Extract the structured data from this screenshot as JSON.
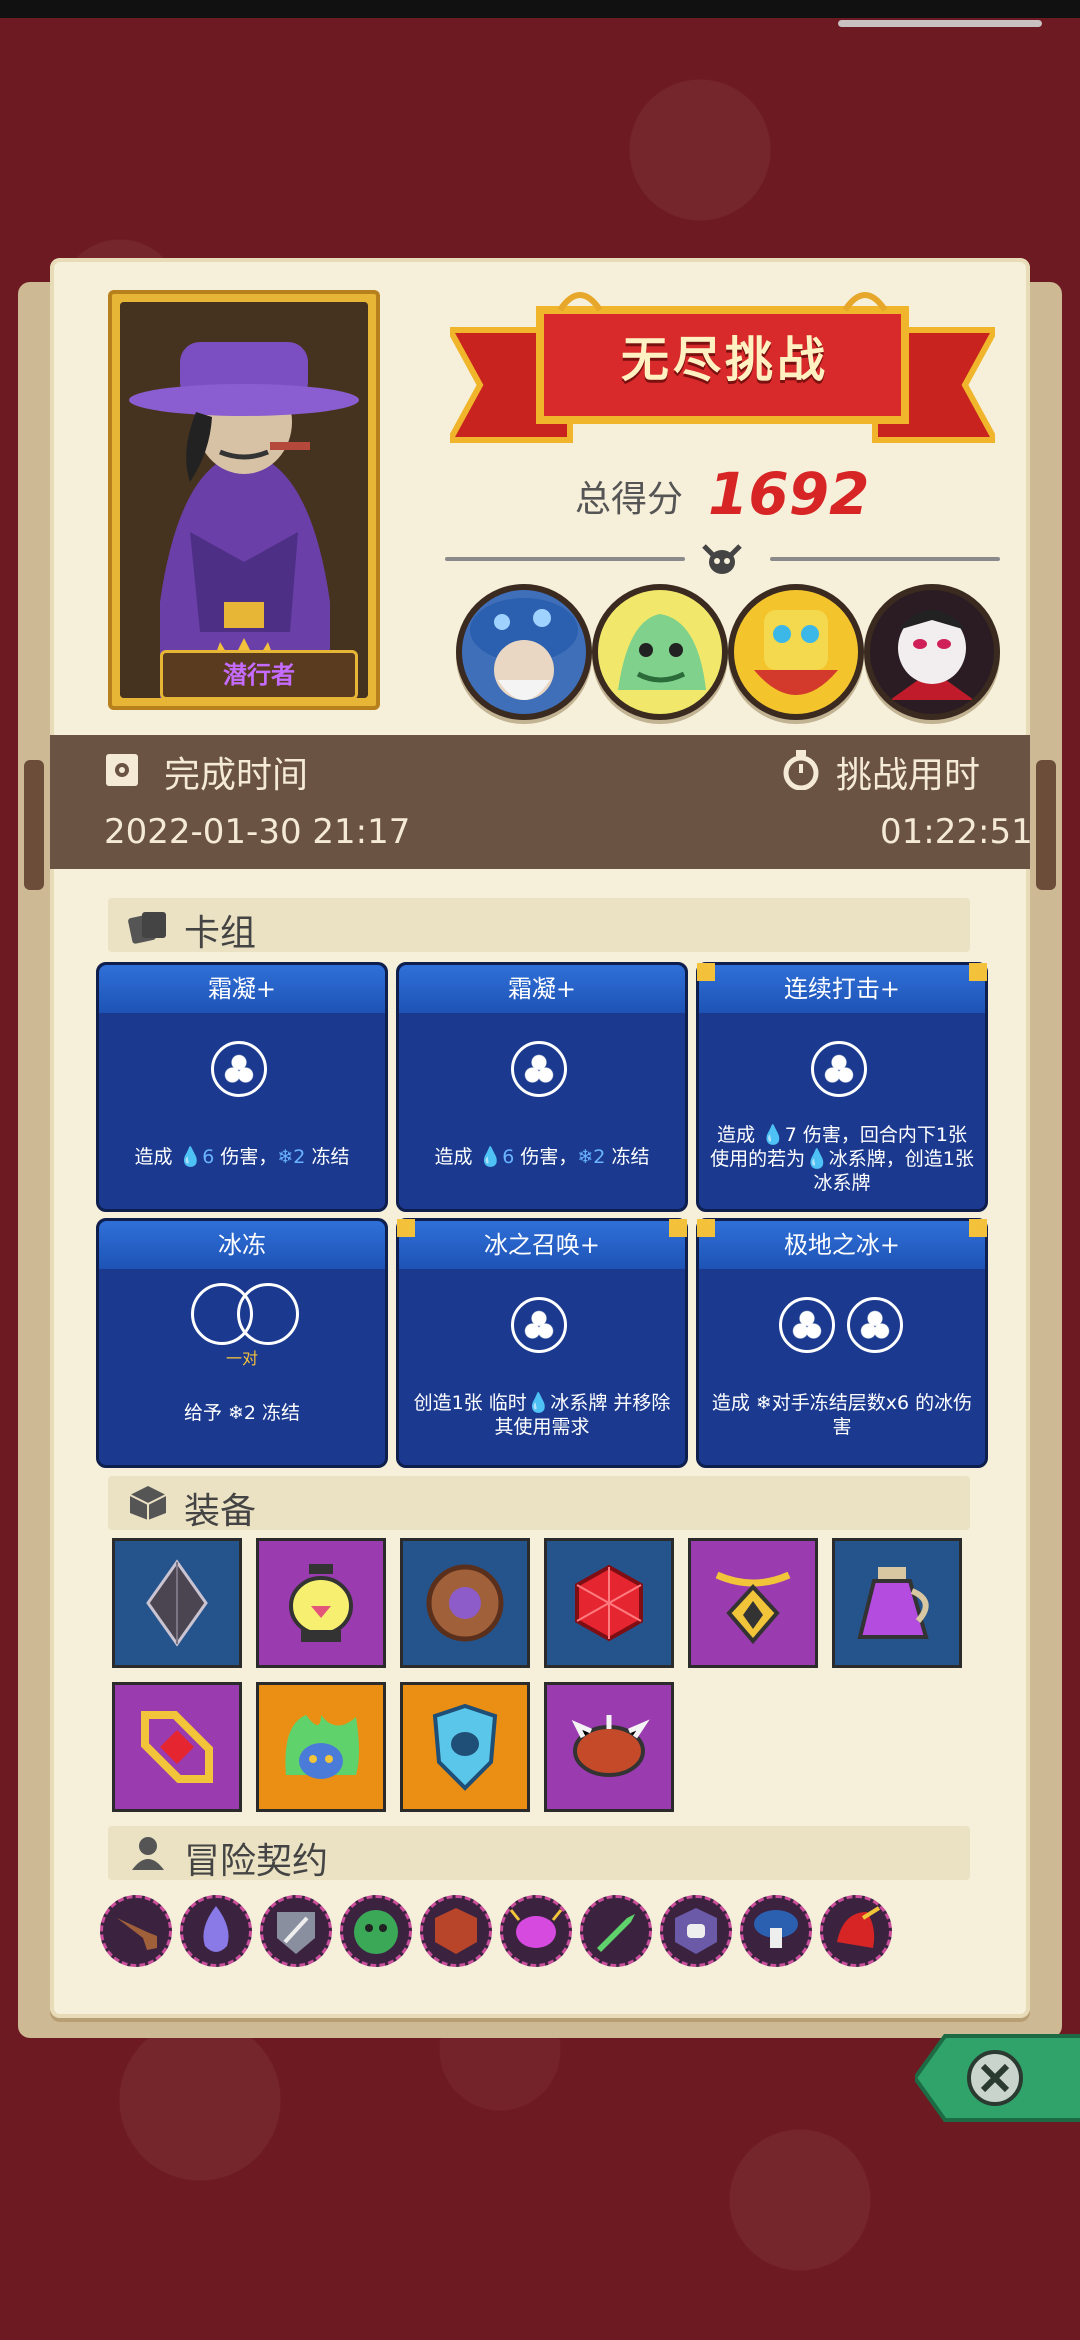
{
  "hero": {
    "name": "潜行者"
  },
  "title": "无尽挑战",
  "score": {
    "label": "总得分",
    "value": "1692"
  },
  "times": {
    "finish_label": "完成时间",
    "finish_value": "2022-01-30  21:17",
    "elapsed_label": "挑战用时",
    "elapsed_value": "01:22:51"
  },
  "sections": {
    "deck": "卡组",
    "equipment": "装备",
    "contracts": "冒险契约"
  },
  "cards": [
    {
      "title": "霜凝+",
      "desc_pre": "造成 ",
      "desc_hl1": "💧6",
      "desc_mid": " 伤害，",
      "desc_hl2": "❄2",
      "desc_post": " 冻结"
    },
    {
      "title": "霜凝+",
      "desc_pre": "造成 ",
      "desc_hl1": "💧6",
      "desc_mid": " 伤害，",
      "desc_hl2": "❄2",
      "desc_post": " 冻结"
    },
    {
      "title": "连续打击+",
      "text": "造成 💧7 伤害，回合内下1张使用的若为💧冰系牌，创造1张冰系牌"
    },
    {
      "title": "冰冻",
      "text": "给予 ❄2 冻结",
      "pair_label": "一对"
    },
    {
      "title": "冰之召唤+",
      "text": "创造1张 临时💧冰系牌 并移除其使用需求"
    },
    {
      "title": "极地之冰+",
      "text": "造成 ❄对手冻结层数x6 的冰伤害"
    }
  ],
  "equipment": [
    {
      "icon": "dark-crystal-icon",
      "rarity": "blue"
    },
    {
      "icon": "lantern-icon",
      "rarity": "purple"
    },
    {
      "icon": "wooden-shield-icon",
      "rarity": "blue"
    },
    {
      "icon": "ruby-gem-icon",
      "rarity": "blue"
    },
    {
      "icon": "gold-amulet-icon",
      "rarity": "purple"
    },
    {
      "icon": "purple-potion-jug-icon",
      "rarity": "blue"
    },
    {
      "icon": "ruby-ring-frame-icon",
      "rarity": "purple"
    },
    {
      "icon": "green-flame-mask-icon",
      "rarity": "orange"
    },
    {
      "icon": "ice-skull-shield-icon",
      "rarity": "orange"
    },
    {
      "icon": "spiked-bracelet-icon",
      "rarity": "purple"
    }
  ],
  "contracts": [
    "pipe-icon",
    "blue-flame-icon",
    "sword-shield-icon",
    "green-monster-icon",
    "dice-shield-icon",
    "purple-bug-icon",
    "green-dagger-icon",
    "fist-shield-icon",
    "mushroom-icon",
    "red-claw-icon"
  ],
  "colors": {
    "background": "#6e1a22",
    "paper": "#f6efd9",
    "banner_red": "#d82a2a",
    "score_red": "#d72525",
    "card_blue": "#1b3a8f",
    "time_band": "#6a5342"
  }
}
